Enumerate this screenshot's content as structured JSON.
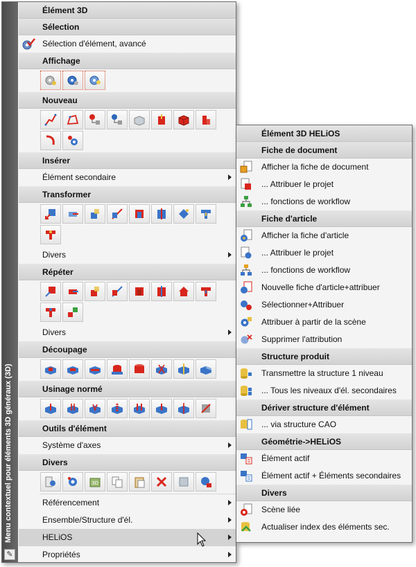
{
  "main_menu": {
    "sidebar_title": "Menu contextuel  pour éléments 3D généraux (3D)",
    "title": "Élément 3D",
    "sections": {
      "selection": {
        "header": "Sélection",
        "item": "Sélection d'élément, avancé"
      },
      "affichage": {
        "header": "Affichage"
      },
      "nouveau": {
        "header": "Nouveau"
      },
      "inserer": {
        "header": "Insérer",
        "item": "Élément secondaire"
      },
      "transformer": {
        "header": "Transformer",
        "item": "Divers"
      },
      "repeter": {
        "header": "Répéter",
        "item": "Divers"
      },
      "decoupage": {
        "header": "Découpage"
      },
      "usinage": {
        "header": "Usinage normé"
      },
      "outils": {
        "header": "Outils d'élément",
        "item": "Système d'axes"
      },
      "divers": {
        "header": "Divers"
      }
    },
    "bottom_items": [
      "Référencement",
      "Ensemble/Structure d'él.",
      "HELiOS",
      "Propriétés"
    ]
  },
  "sub_menu": {
    "title": "Élément 3D HELiOS",
    "fiche_document": {
      "header": "Fiche de document",
      "items": [
        "Afficher la fiche de document",
        "... Attribuer le projet",
        "... fonctions de workflow"
      ]
    },
    "fiche_article": {
      "header": "Fiche d'article",
      "items": [
        "Afficher la fiche d'article",
        "... Attribuer le projet",
        "... fonctions de workflow",
        "Nouvelle fiche d'article+attribuer",
        "Sélectionner+Attribuer",
        "Attribuer à partir de la scène",
        "Supprimer l'attribution"
      ]
    },
    "structure_produit": {
      "header": "Structure produit",
      "items": [
        "Transmettre la structure 1 niveau",
        "... Tous les niveaux d'él. secondaires"
      ]
    },
    "deriver": {
      "header": "Dériver structure d'élément",
      "items": [
        "... via structure CAO"
      ]
    },
    "geometrie": {
      "header": "Géométrie->HELiOS",
      "items": [
        "Élément actif",
        "Élément actif + Éléments secondaires"
      ]
    },
    "divers": {
      "header": "Divers",
      "items": [
        "Scène liée",
        "Actualiser index des éléments sec."
      ]
    }
  },
  "colors": {
    "accent_red": "#d8261c",
    "accent_blue": "#2c67b8",
    "header_bg": "#d6d6d6",
    "sidebar_bg": "#555555",
    "highlight": "#d3d3d3"
  }
}
